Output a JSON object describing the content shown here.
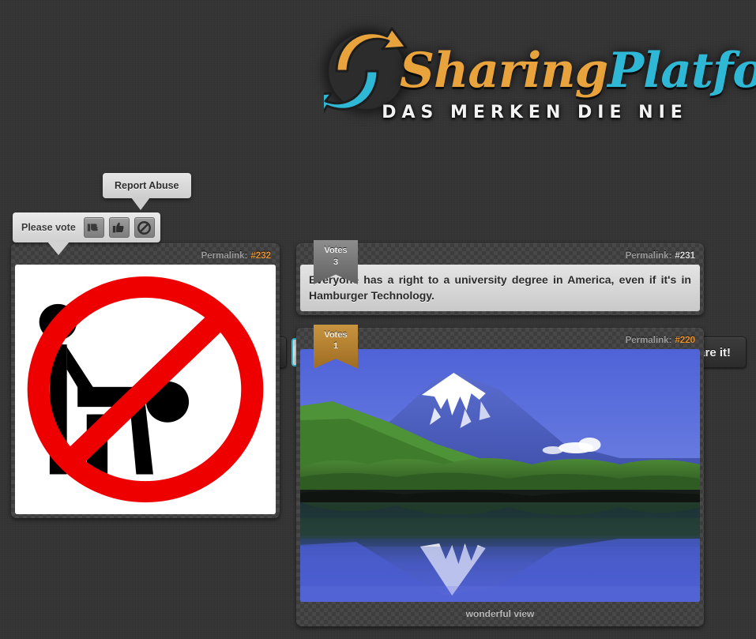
{
  "site": {
    "logo_word_1": "Sharing",
    "logo_word_2": "Platform",
    "tagline": "DAS MERKEN DIE NIE",
    "accent_orange": "#e8a33d",
    "accent_cyan": "#2fb8d6",
    "background": "#343434"
  },
  "toolbar": {
    "upload_icon": "upload-icon",
    "share_input_value": "",
    "share_input_placeholder": "",
    "share_button_label": "Share it!"
  },
  "vote_widget": {
    "label": "Please vote",
    "buttons": [
      {
        "name": "thumbs-down-icon",
        "title": "Vote down"
      },
      {
        "name": "thumbs-up-icon",
        "title": "Vote up"
      },
      {
        "name": "block-icon",
        "title": "Report"
      }
    ]
  },
  "tooltip": {
    "label": "Report Abuse"
  },
  "posts": {
    "left": [
      {
        "permalink_label": "Permalink:",
        "permalink_id": "#232",
        "permalink_highlight": true,
        "type": "image",
        "media": "no-sitting-sign",
        "caption": "",
        "votes_label": "",
        "votes_count": ""
      }
    ],
    "right": [
      {
        "permalink_label": "Permalink:",
        "permalink_id": "#231",
        "permalink_highlight": false,
        "type": "text",
        "text": "Everyone has a right to a university degree in America, even if it's in Hamburger Technology.",
        "caption": "",
        "votes_label": "Votes",
        "votes_count": "3",
        "ribbon_style": "gray"
      },
      {
        "permalink_label": "Permalink:",
        "permalink_id": "#220",
        "permalink_highlight": true,
        "type": "image",
        "media": "mount-fuji-lake",
        "caption": "wonderful view",
        "votes_label": "Votes",
        "votes_count": "1",
        "ribbon_style": "bronze"
      }
    ]
  }
}
